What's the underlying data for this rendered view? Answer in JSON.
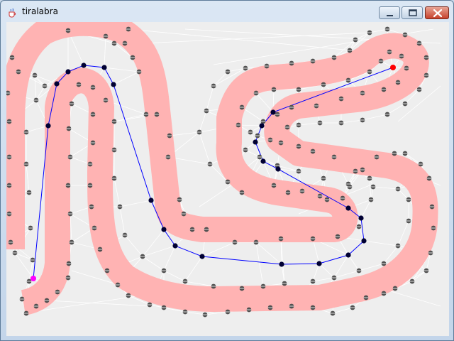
{
  "window": {
    "title": "tiralabra"
  },
  "controls": {
    "minimize": "minimize",
    "maximize": "maximize",
    "close": "close"
  },
  "icons": {
    "app": "java-cup-icon",
    "minimize": "minimize-icon",
    "maximize": "maximize-icon",
    "close": "close-icon"
  },
  "colors": {
    "canvas_bg": "#eeeeee",
    "track": "#ffb3b3",
    "graph_edges": "#ffffff",
    "path": "#0000ff",
    "node_on_path": "#000033",
    "node_other": "#505050",
    "start": "#ff00ff",
    "goal": "#ff0000"
  }
}
